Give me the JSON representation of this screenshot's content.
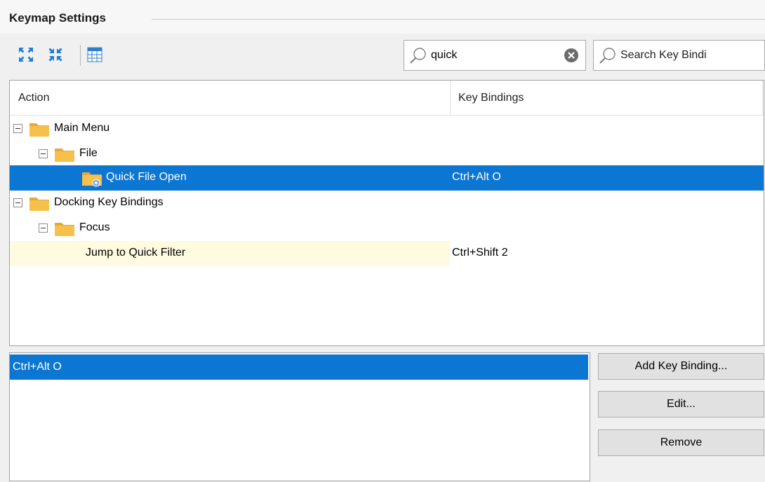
{
  "panel": {
    "title": "Keymap Settings"
  },
  "toolbar": {
    "expand_all_icon": "expand-all-icon",
    "collapse_all_icon": "collapse-all-icon",
    "grid_icon": "grid-icon"
  },
  "filter": {
    "value": "quick",
    "clear_icon": "clear-icon"
  },
  "key_search": {
    "placeholder": "Search Key Bindi"
  },
  "tree": {
    "columns": [
      "Action",
      "Key Bindings"
    ],
    "rows": [
      {
        "label": "Main Menu",
        "binding": "",
        "level": 0,
        "expandable": true,
        "icon": "folder-icon"
      },
      {
        "label": "File",
        "binding": "",
        "level": 1,
        "expandable": true,
        "icon": "folder-icon"
      },
      {
        "label": "Quick File Open",
        "binding": "Ctrl+Alt O",
        "level": 2,
        "expandable": false,
        "icon": "command-folder-icon",
        "selected": true
      },
      {
        "label": "Docking Key Bindings",
        "binding": "",
        "level": 0,
        "expandable": true,
        "icon": "folder-icon"
      },
      {
        "label": "Focus",
        "binding": "",
        "level": 1,
        "expandable": true,
        "icon": "folder-icon"
      },
      {
        "label": "Jump to Quick Filter",
        "binding": "Ctrl+Shift 2",
        "level": 2,
        "expandable": false,
        "icon": "",
        "hovered": true
      }
    ]
  },
  "bindings_list": {
    "items": [
      "Ctrl+Alt O"
    ]
  },
  "buttons": {
    "add": "Add Key Binding...",
    "edit": "Edit...",
    "remove": "Remove"
  },
  "colors": {
    "selection": "#0c76d3",
    "hover": "#fffbe0",
    "folder": "#f6c14b"
  }
}
